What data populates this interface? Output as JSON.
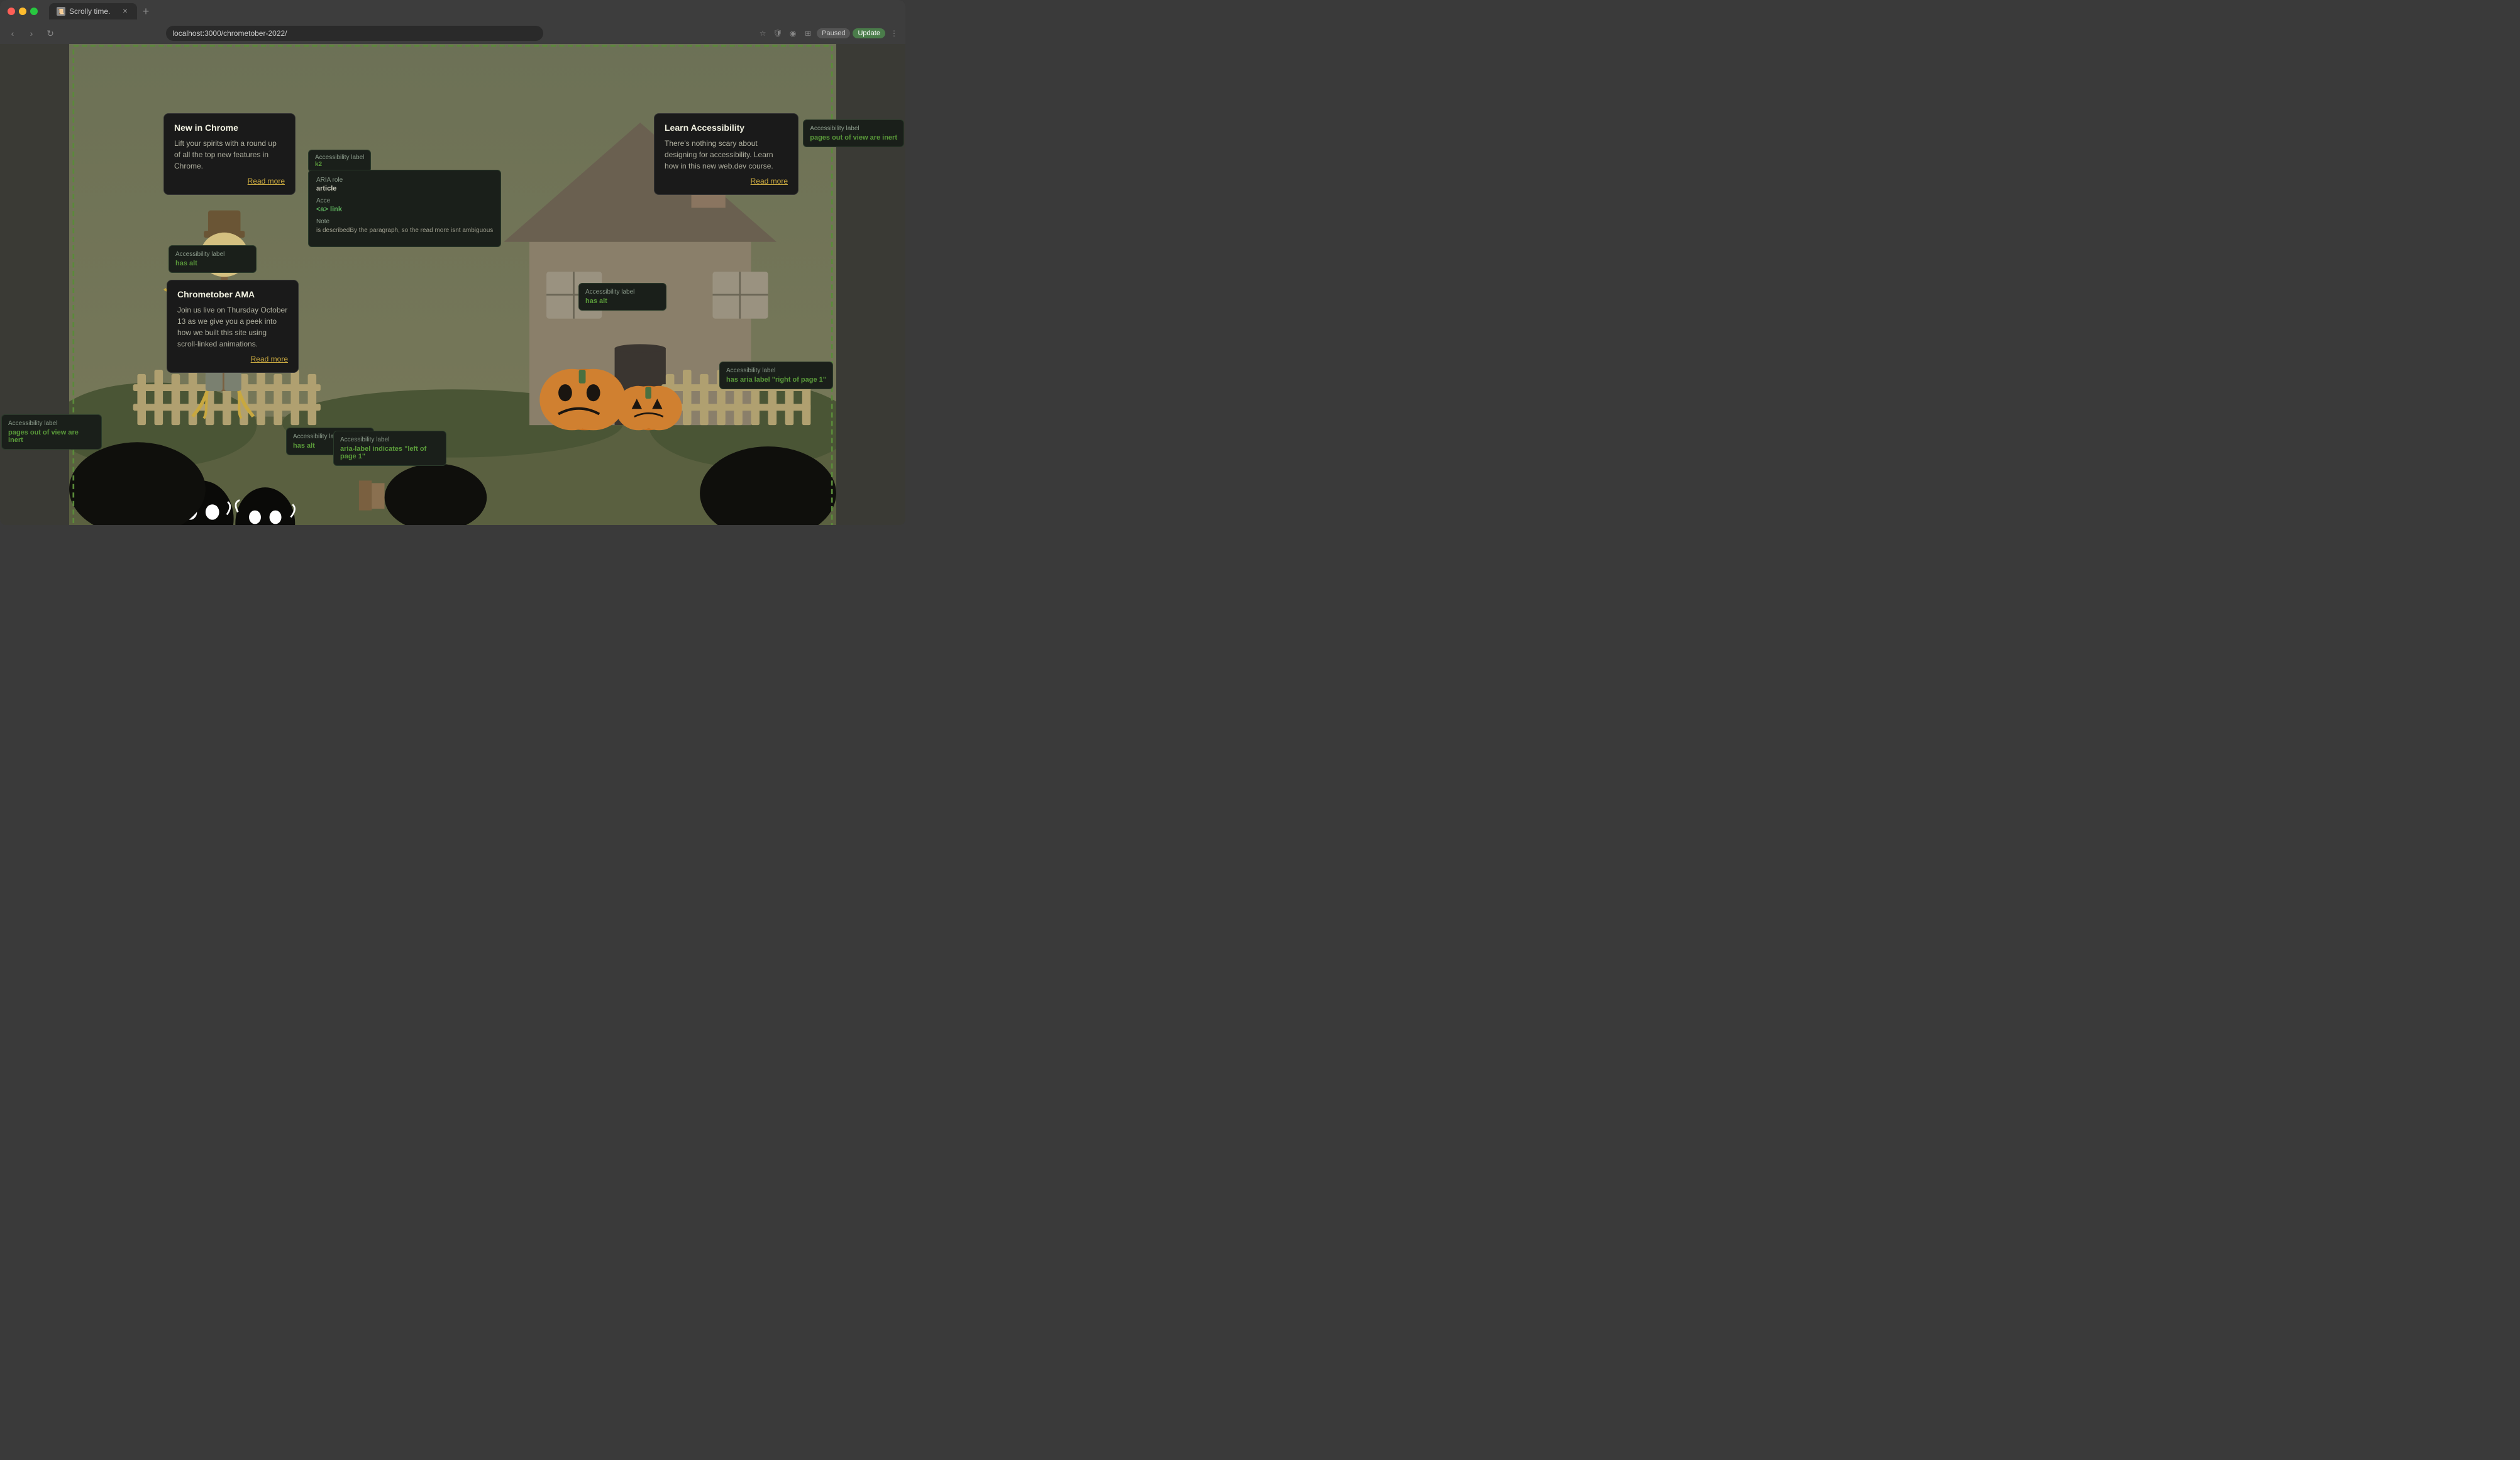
{
  "browser": {
    "tab_title": "Scrolly time.",
    "url": "localhost:3000/chrometober-2022/",
    "new_tab_symbol": "+",
    "nav": {
      "back": "‹",
      "forward": "›",
      "reload": "↻"
    },
    "toolbar": {
      "paused_label": "Paused",
      "update_label": "Update"
    }
  },
  "cards": {
    "new_in_chrome": {
      "title": "New in Chrome",
      "body": "Lift your spirits with a round up of all the top new features in Chrome.",
      "read_more": "Read more"
    },
    "learn_accessibility": {
      "title": "Learn Accessibility",
      "body": "There's nothing scary about designing for accessibility. Learn how in this new web.dev course.",
      "read_more": "Read more"
    },
    "chrometober_ama": {
      "title": "Chrometober AMA",
      "body": "Join us live on Thursday October 13 as we give you a peek into how we built this site using scroll-linked animations.",
      "read_more": "Read more"
    }
  },
  "a11y_tooltips": {
    "has_alt_1": {
      "label": "Accessibility label",
      "value": "has alt"
    },
    "has_alt_2": {
      "label": "Accessibility label",
      "value": "has alt"
    },
    "has_alt_3": {
      "label": "Accessibility label",
      "value": "has alt"
    },
    "pages_out_of_view_left": {
      "label": "Accessibility label",
      "value": "pages out of view are inert"
    },
    "pages_out_of_view_right": {
      "label": "Accessibility label",
      "value": "pages out of view are inert"
    },
    "aria_label_right": {
      "label": "Accessibility label",
      "value": "has aria label \"right of page 1\""
    },
    "aria_label_left": {
      "label": "Accessibility label",
      "value": "aria-label indicates \"left of page 1\""
    }
  },
  "aria_popup": {
    "aria_role_label": "ARIA role",
    "aria_role_value": "article",
    "acce_label": "Acce",
    "acce_value": "<a> link",
    "note_label": "Note",
    "note_value": "is describedBy the paragraph, so the read more isnt ambiguous"
  },
  "acce_tooltips": {
    "small_1": {
      "label": "Acce",
      "value": "k2"
    }
  }
}
